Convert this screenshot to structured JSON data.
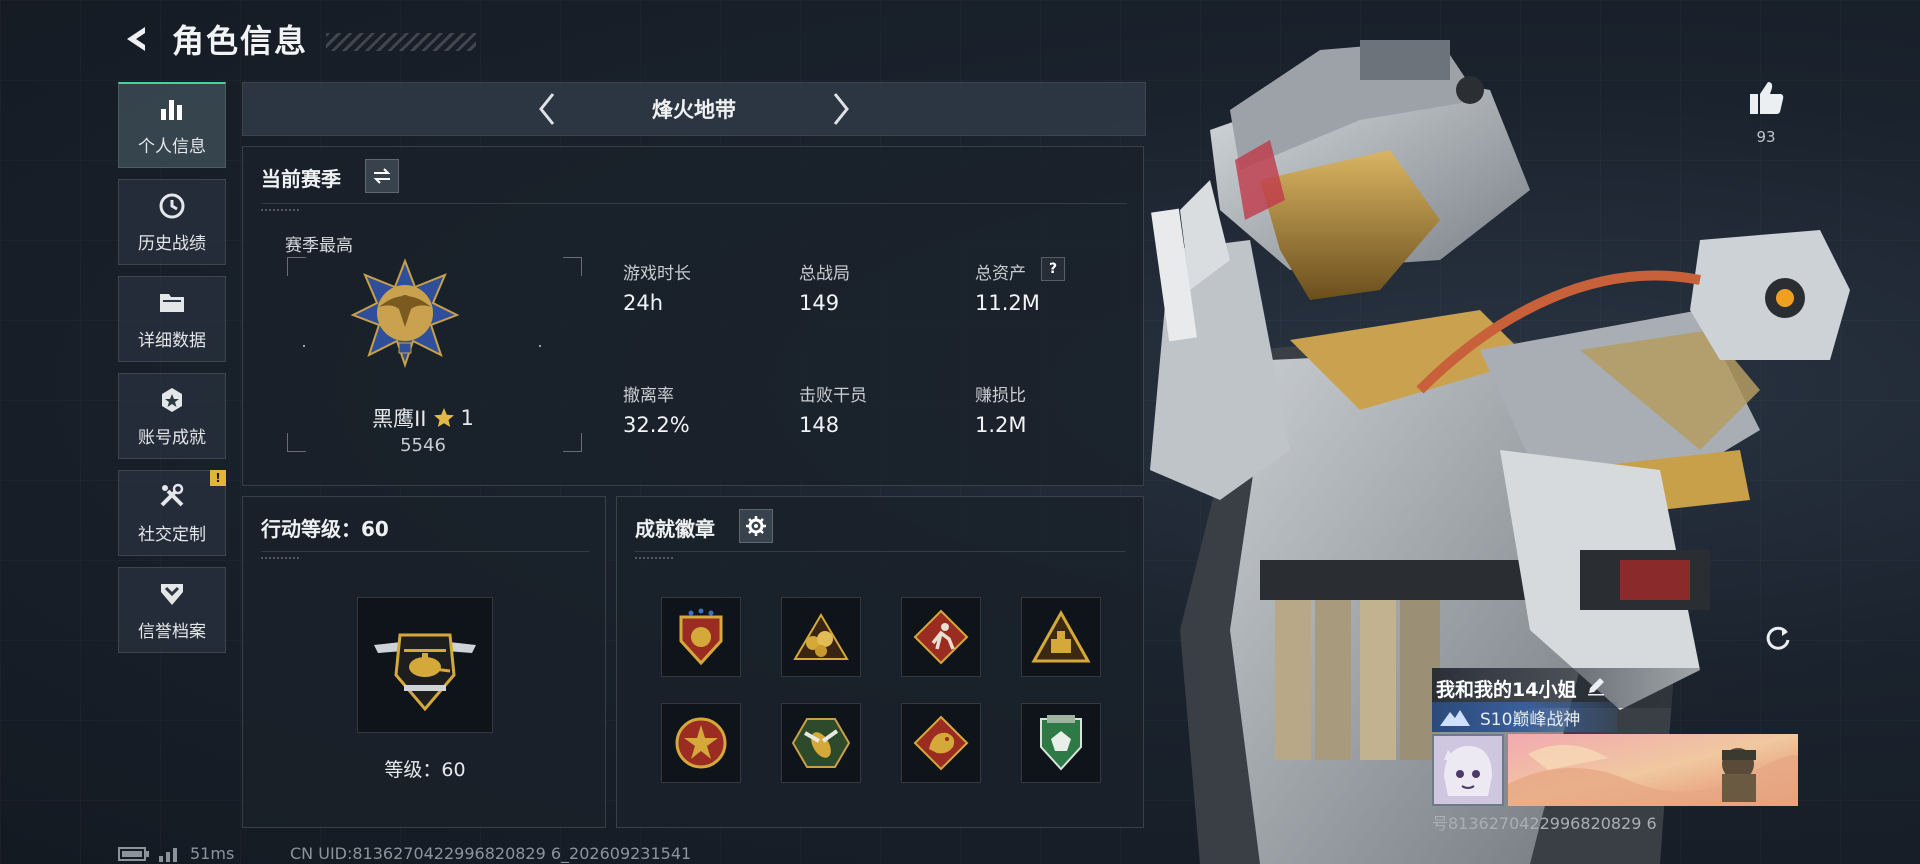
{
  "header": {
    "title": "角色信息"
  },
  "sidebar": {
    "items": [
      {
        "label": "个人信息",
        "icon": "bar-chart-icon",
        "active": true
      },
      {
        "label": "历史战绩",
        "icon": "clock-history-icon"
      },
      {
        "label": "详细数据",
        "icon": "folder-icon"
      },
      {
        "label": "账号成就",
        "icon": "star-badge-icon"
      },
      {
        "label": "社交定制",
        "icon": "wrench-tools-icon",
        "alert": "!"
      },
      {
        "label": "信誉档案",
        "icon": "shield-chevron-icon"
      }
    ]
  },
  "mode": {
    "title": "烽火地带"
  },
  "season": {
    "title": "当前赛季",
    "best_label": "赛季最高",
    "rank_name": "黑鹰II",
    "rank_stars": "1",
    "rank_points": "5546",
    "stats": [
      {
        "label": "游戏时长",
        "value": "24h"
      },
      {
        "label": "总战局",
        "value": "149"
      },
      {
        "label": "总资产",
        "value": "11.2M",
        "help": "?"
      },
      {
        "label": "撤离率",
        "value": "32.2%"
      },
      {
        "label": "击败干员",
        "value": "148"
      },
      {
        "label": "赚损比",
        "value": "1.2M"
      }
    ]
  },
  "action_level": {
    "title": "行动等级：60",
    "level_text": "等级：60"
  },
  "achievements": {
    "title": "成就徽章",
    "badges": [
      {
        "icon": "shield-stars-badge-icon",
        "color": "#c9982e"
      },
      {
        "icon": "gold-nuggets-badge-icon",
        "color": "#d4a93a"
      },
      {
        "icon": "runner-diamond-badge-icon",
        "color": "#b5402c"
      },
      {
        "icon": "supply-triangle-badge-icon",
        "color": "#c9982e"
      },
      {
        "icon": "star-medal-badge-icon",
        "color": "#b5402c"
      },
      {
        "icon": "hornet-hexagon-badge-icon",
        "color": "#3f7a3a"
      },
      {
        "icon": "dragon-diamond-badge-icon",
        "color": "#b5402c"
      },
      {
        "icon": "green-shield-badge-icon",
        "color": "#2e7a46"
      }
    ]
  },
  "status": {
    "ping": "51ms",
    "uid": "CN UID:8136270422996820829 6_202609231541"
  },
  "profile": {
    "like_count": "93",
    "player_name": "我和我的14小姐",
    "title_badge": "S10巅峰战神",
    "uid_partial": "号8136270422996820829 6"
  },
  "colors": {
    "accent_green": "#4ecf9a",
    "gold": "#d4a93a",
    "alert_yellow": "#e0b53a"
  }
}
